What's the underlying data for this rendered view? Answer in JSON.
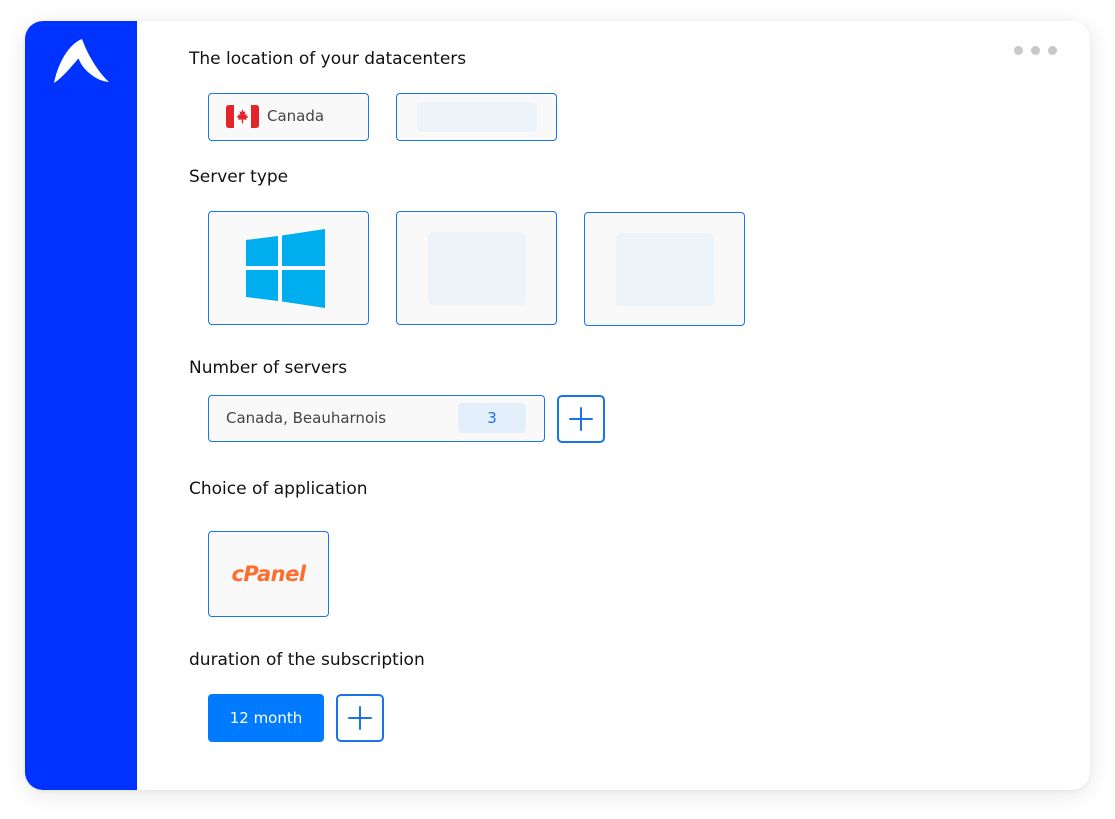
{
  "sections": {
    "location_title": "The location of your datacenters",
    "server_type_title": "Server type",
    "number_title": "Number of servers",
    "application_title": "Choice of application",
    "duration_title": "duration of the subscription"
  },
  "location": {
    "selected_country": "Canada",
    "flag_icon": "canada-flag-icon"
  },
  "server_type": {
    "selected_icon": "windows-logo-icon"
  },
  "servers": {
    "location_label": "Canada, Beauharnois",
    "count": "3"
  },
  "application": {
    "selected": "cPanel"
  },
  "duration": {
    "value": "12 month"
  },
  "colors": {
    "sidebar": "#0033ff",
    "accent": "#1a74e8",
    "button": "#007bff",
    "windows": "#00adef",
    "cpanel": "#ff6c2c"
  }
}
